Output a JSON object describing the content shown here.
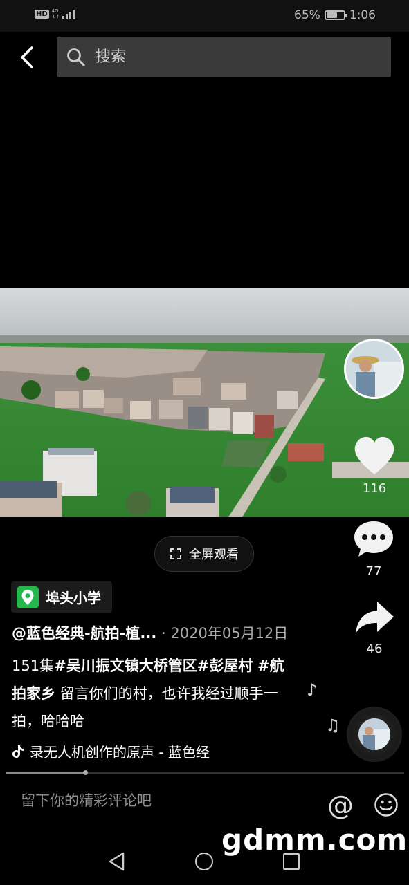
{
  "status_bar": {
    "hd": "HD",
    "network": "4G",
    "battery_percent": "65%",
    "battery_level": 0.65,
    "time": "1:06"
  },
  "search": {
    "placeholder": "搜索"
  },
  "video": {
    "fullscreen_label": "全屏观看"
  },
  "actions": {
    "likes": "116",
    "comments": "77",
    "shares": "46"
  },
  "location": {
    "name": "埠头小学"
  },
  "post": {
    "author": "@蓝色经典-航拍-植...",
    "date": " · 2020年05月12日",
    "episode": "151集",
    "hashtag1": "#吴川振文镇大桥管区",
    "hashtag2": "#彭屋村",
    "hashtag3": "#航拍家乡",
    "caption": " 留言你们的村，也许我经过顺手一拍，哈哈哈"
  },
  "music": {
    "title": "录无人机创作的原声 - 蓝色经"
  },
  "playback": {
    "progress": 0.2
  },
  "comment": {
    "placeholder": "留下你的精彩评论吧"
  },
  "watermark": "gdmm.com",
  "icons": {
    "back": "chevron-left-icon",
    "search": "search-icon",
    "like": "heart-icon",
    "comment": "comment-bubble-icon",
    "share": "share-arrow-icon",
    "location": "location-pin-icon",
    "music": "tiktok-note-icon",
    "at": "at-icon",
    "emoji": "smiley-icon"
  },
  "colors": {
    "accent_green": "#25b64c",
    "background": "#000000",
    "search_bg": "#3a3a3a"
  }
}
